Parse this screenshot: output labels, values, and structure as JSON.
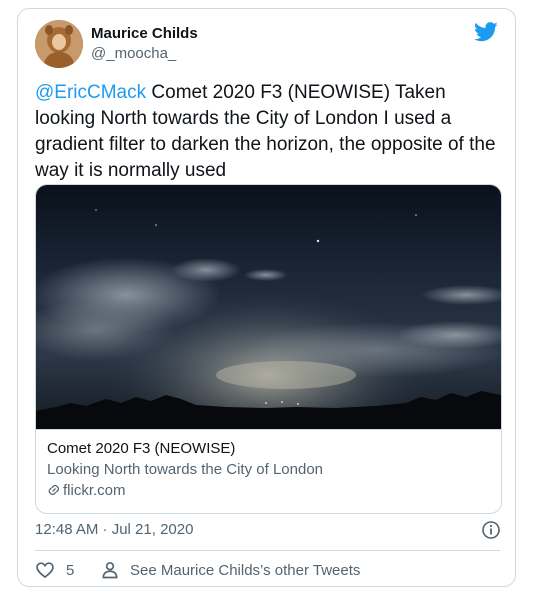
{
  "tweet": {
    "author": {
      "display_name": "Maurice Childs",
      "handle": "@_moocha_",
      "avatar_icon": "avatar"
    },
    "platform_icon": "twitter-bird-icon",
    "mention": "@EricCMack",
    "text": " Comet 2020 F3 (NEOWISE) Taken looking North towards the City of London I used a gradient filter to darken the horizon, the opposite of the way it is normally used",
    "link_card": {
      "title": "Comet 2020 F3 (NEOWISE)",
      "description": "Looking North towards the City of London",
      "domain": "flickr.com"
    },
    "timestamp": "12:48 AM · Jul 21, 2020",
    "actions": {
      "like_count": "5",
      "profile_link_label": "See Maurice Childs’s other Tweets"
    }
  },
  "colors": {
    "accent": "#1d9bf0",
    "text": "#0f1419",
    "secondary_text": "#536471",
    "border": "#cfd9de"
  }
}
